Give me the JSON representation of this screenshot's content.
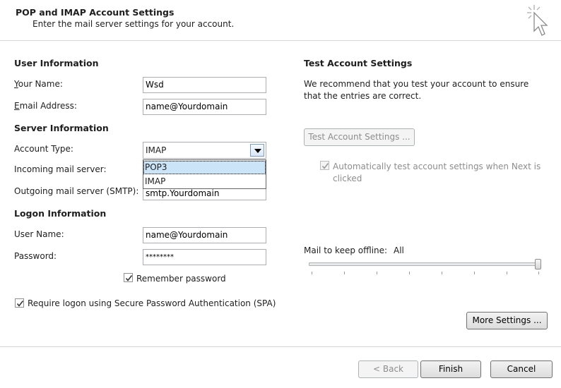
{
  "header": {
    "title": "POP and IMAP Account Settings",
    "subtitle": "Enter the mail server settings for your account."
  },
  "user_info": {
    "heading": "User Information",
    "your_name_label": "Your Name:",
    "your_name_value": "Wsd",
    "email_label": "Email Address:",
    "email_value": "name@Yourdomain"
  },
  "server_info": {
    "heading": "Server Information",
    "account_type_label": "Account Type:",
    "account_type_value": "IMAP",
    "account_type_options": [
      "POP3",
      "IMAP"
    ],
    "incoming_label": "Incoming mail server:",
    "outgoing_label": "Outgoing mail server (SMTP):",
    "outgoing_value": "smtp.Yourdomain"
  },
  "logon_info": {
    "heading": "Logon Information",
    "username_label": "User Name:",
    "username_value": "name@Yourdomain",
    "password_label": "Password:",
    "password_value": "********",
    "remember_label": "Remember password",
    "remember_checked": true,
    "spa_label": "Require logon using Secure Password Authentication (SPA)",
    "spa_checked": true
  },
  "test_settings": {
    "heading": "Test Account Settings",
    "description": "We recommend that you test your account to ensure that the entries are correct.",
    "test_button": "Test Account Settings ...",
    "auto_test_label": "Automatically test account settings when Next is clicked",
    "auto_test_checked": true
  },
  "offline": {
    "label": "Mail to keep offline:",
    "value": "All",
    "slider_fraction": 1.0
  },
  "buttons": {
    "more_settings": "More Settings ...",
    "back": "< Back",
    "finish": "Finish",
    "cancel": "Cancel"
  }
}
